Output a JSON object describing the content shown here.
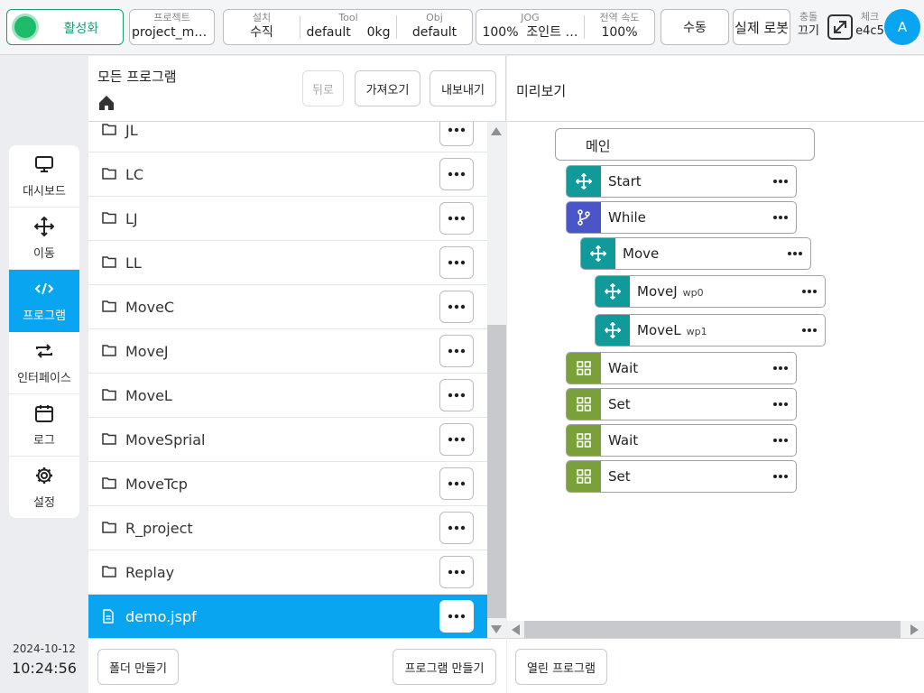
{
  "topbar": {
    "activate_label": "활성화",
    "project": {
      "key": "프로젝트",
      "value": "project_mo…"
    },
    "install": {
      "key": "설치",
      "value": "수직"
    },
    "tool": {
      "key": "Tool",
      "value_name": "default",
      "value_weight": "0kg"
    },
    "obj": {
      "key": "Obj",
      "value": "default"
    },
    "jog": {
      "key": "JOG",
      "value_pct": "100%",
      "value_mode": "조인트 …"
    },
    "global_speed": {
      "key": "전역 속도",
      "value": "100%"
    },
    "manual_label": "수동",
    "real_robot_label": "실제 로봇",
    "collision": {
      "key": "충돌",
      "value": "끄기"
    },
    "check": {
      "key": "체크",
      "value": "e4c5"
    },
    "avatar_letter": "A"
  },
  "sidenav": {
    "items": [
      {
        "label": "대시보드",
        "icon": "monitor-icon"
      },
      {
        "label": "이동",
        "icon": "move-arrows-icon"
      },
      {
        "label": "프로그램",
        "icon": "code-icon"
      },
      {
        "label": "인터페이스",
        "icon": "swap-icon"
      },
      {
        "label": "로그",
        "icon": "calendar-icon"
      },
      {
        "label": "설정",
        "icon": "gear-icon"
      }
    ],
    "active_index": 2
  },
  "clock": {
    "date": "2024-10-12",
    "time": "10:24:56"
  },
  "files": {
    "title": "모든 프로그램",
    "back_label": "뒤로",
    "import_label": "가져오기",
    "export_label": "내보내기",
    "items": [
      {
        "name": "JL",
        "type": "folder"
      },
      {
        "name": "LC",
        "type": "folder"
      },
      {
        "name": "LJ",
        "type": "folder"
      },
      {
        "name": "LL",
        "type": "folder"
      },
      {
        "name": "MoveC",
        "type": "folder"
      },
      {
        "name": "MoveJ",
        "type": "folder"
      },
      {
        "name": "MoveL",
        "type": "folder"
      },
      {
        "name": "MoveSprial",
        "type": "folder"
      },
      {
        "name": "MoveTcp",
        "type": "folder"
      },
      {
        "name": "R_project",
        "type": "folder"
      },
      {
        "name": "Replay",
        "type": "folder"
      },
      {
        "name": "demo.jspf",
        "type": "file",
        "selected": true
      }
    ],
    "make_folder_label": "폴더 만들기",
    "make_program_label": "프로그램 만들기"
  },
  "preview": {
    "title": "미리보기",
    "main_label": "메인",
    "nodes": [
      {
        "label": "Start",
        "sub": "",
        "color": "#119a9a",
        "icon": "move-arrows-icon"
      },
      {
        "label": "While",
        "sub": "",
        "color": "#4a55c8",
        "icon": "branch-icon"
      },
      {
        "label": "Move",
        "sub": "",
        "color": "#119a9a",
        "icon": "move-arrows-icon"
      },
      {
        "label": "MoveJ",
        "sub": "wp0",
        "color": "#119a9a",
        "icon": "move-arrows-icon"
      },
      {
        "label": "MoveL",
        "sub": "wp1",
        "color": "#119a9a",
        "icon": "move-arrows-icon"
      },
      {
        "label": "Wait",
        "sub": "",
        "color": "#7aa03a",
        "icon": "grid-icon"
      },
      {
        "label": "Set",
        "sub": "",
        "color": "#7aa03a",
        "icon": "grid-icon"
      },
      {
        "label": "Wait",
        "sub": "",
        "color": "#7aa03a",
        "icon": "grid-icon"
      },
      {
        "label": "Set",
        "sub": "",
        "color": "#7aa03a",
        "icon": "grid-icon"
      }
    ],
    "open_program_label": "열린 프로그램"
  },
  "colors": {
    "accent": "#0aa5f0",
    "active_green": "#1a9b74",
    "teal": "#119a9a",
    "purple": "#4a55c8",
    "green": "#7aa03a"
  }
}
